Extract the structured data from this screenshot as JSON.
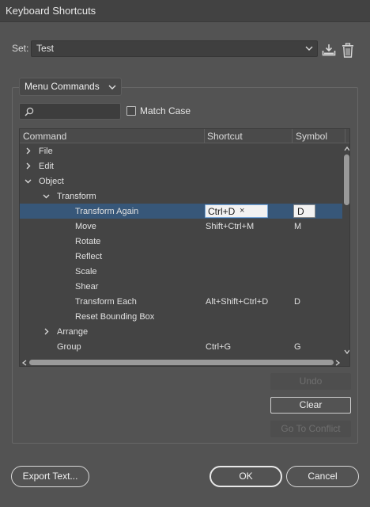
{
  "window": {
    "title": "Keyboard Shortcuts"
  },
  "set": {
    "label": "Set:",
    "value": "Test"
  },
  "type_dropdown": {
    "value": "Menu Commands"
  },
  "search": {
    "placeholder": ""
  },
  "match_case": {
    "label": "Match Case",
    "checked": false
  },
  "table": {
    "headers": {
      "command": "Command",
      "shortcut": "Shortcut",
      "symbol": "Symbol"
    },
    "rows": [
      {
        "command": "File",
        "shortcut": "",
        "symbol": "",
        "level": 0,
        "expander": "collapsed"
      },
      {
        "command": "Edit",
        "shortcut": "",
        "symbol": "",
        "level": 0,
        "expander": "collapsed"
      },
      {
        "command": "Object",
        "shortcut": "",
        "symbol": "",
        "level": 0,
        "expander": "expanded"
      },
      {
        "command": "Transform",
        "shortcut": "",
        "symbol": "",
        "level": 1,
        "expander": "expanded"
      },
      {
        "command": "Transform Again",
        "shortcut": "Ctrl+D",
        "symbol": "D",
        "level": 2,
        "expander": "none",
        "selected": true
      },
      {
        "command": "Move",
        "shortcut": "Shift+Ctrl+M",
        "symbol": "M",
        "level": 2,
        "expander": "none"
      },
      {
        "command": "Rotate",
        "shortcut": "",
        "symbol": "",
        "level": 2,
        "expander": "none"
      },
      {
        "command": "Reflect",
        "shortcut": "",
        "symbol": "",
        "level": 2,
        "expander": "none"
      },
      {
        "command": "Scale",
        "shortcut": "",
        "symbol": "",
        "level": 2,
        "expander": "none"
      },
      {
        "command": "Shear",
        "shortcut": "",
        "symbol": "",
        "level": 2,
        "expander": "none"
      },
      {
        "command": "Transform Each",
        "shortcut": "Alt+Shift+Ctrl+D",
        "symbol": "D",
        "level": 2,
        "expander": "none"
      },
      {
        "command": "Reset Bounding Box",
        "shortcut": "",
        "symbol": "",
        "level": 2,
        "expander": "none"
      },
      {
        "command": "Arrange",
        "shortcut": "",
        "symbol": "",
        "level": 1,
        "expander": "collapsed"
      },
      {
        "command": "Group",
        "shortcut": "Ctrl+G",
        "symbol": "G",
        "level": 1,
        "expander": "none"
      }
    ],
    "clear_shortcut_glyph": "×"
  },
  "side_buttons": {
    "undo": "Undo",
    "clear": "Clear",
    "goto_conflict": "Go To Conflict"
  },
  "footer": {
    "export": "Export Text...",
    "ok": "OK",
    "cancel": "Cancel"
  },
  "colors": {
    "selection": "#375779",
    "background": "#535353"
  }
}
